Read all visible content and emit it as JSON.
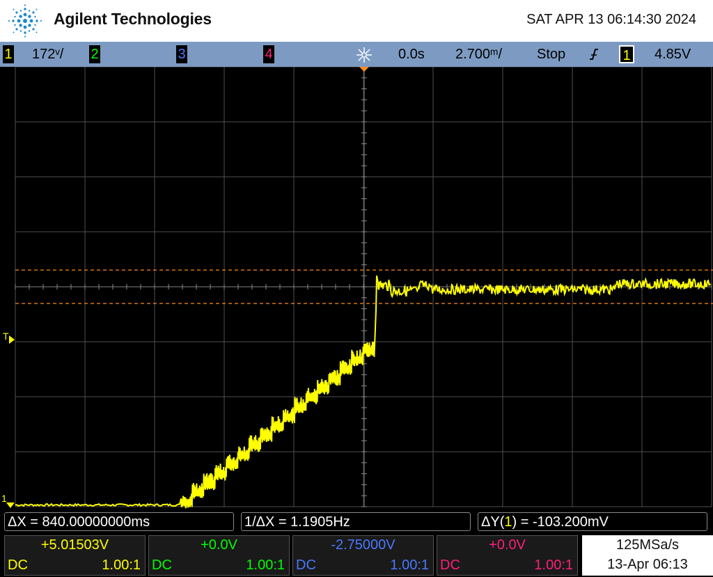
{
  "header": {
    "brand": "Agilent Technologies",
    "datetime": "SAT APR 13 06:14:30 2024"
  },
  "status_bar": {
    "ch1": {
      "number": "1",
      "scale": "172ᵛ/",
      "color": "#ffff00"
    },
    "ch2": {
      "number": "2",
      "color": "#00ff00"
    },
    "ch3": {
      "number": "3",
      "color": "#4a78ff"
    },
    "ch4": {
      "number": "4",
      "color": "#ff1f7a"
    },
    "acq_icon": "acquisition-icon",
    "time_delay": "0.0s",
    "time_scale": "2.700ᵐ/",
    "run_state": "Stop",
    "trigger_edge_icon": "rising-edge-icon",
    "trigger_source": "1",
    "trigger_level": "4.85V"
  },
  "screen": {
    "left_markers": {
      "trigger": "T",
      "ch1_ground": "1"
    }
  },
  "measurements": {
    "delta_x": "ΔX = 840.00000000ms",
    "inv_delta_x": "1/ΔX = 1.1905Hz",
    "delta_y_prefix": "ΔY(",
    "delta_y_channel": "1",
    "delta_y_suffix": ") = -103.200mV"
  },
  "channels": [
    {
      "offset": "+5.01503V",
      "coupling": "DC",
      "probe": "1.00:1",
      "color": "#ffff00"
    },
    {
      "offset": "+0.0V",
      "coupling": "DC",
      "probe": "1.00:1",
      "color": "#00ff00"
    },
    {
      "offset": "-2.75000V",
      "coupling": "DC",
      "probe": "1.00:1",
      "color": "#4a78ff"
    },
    {
      "offset": "+0.0V",
      "coupling": "DC",
      "probe": "1.00:1",
      "color": "#ff1f7a"
    }
  ],
  "acquisition": {
    "sample_rate": "125MSa/s",
    "last_acq": "13-Apr 06:13"
  }
}
